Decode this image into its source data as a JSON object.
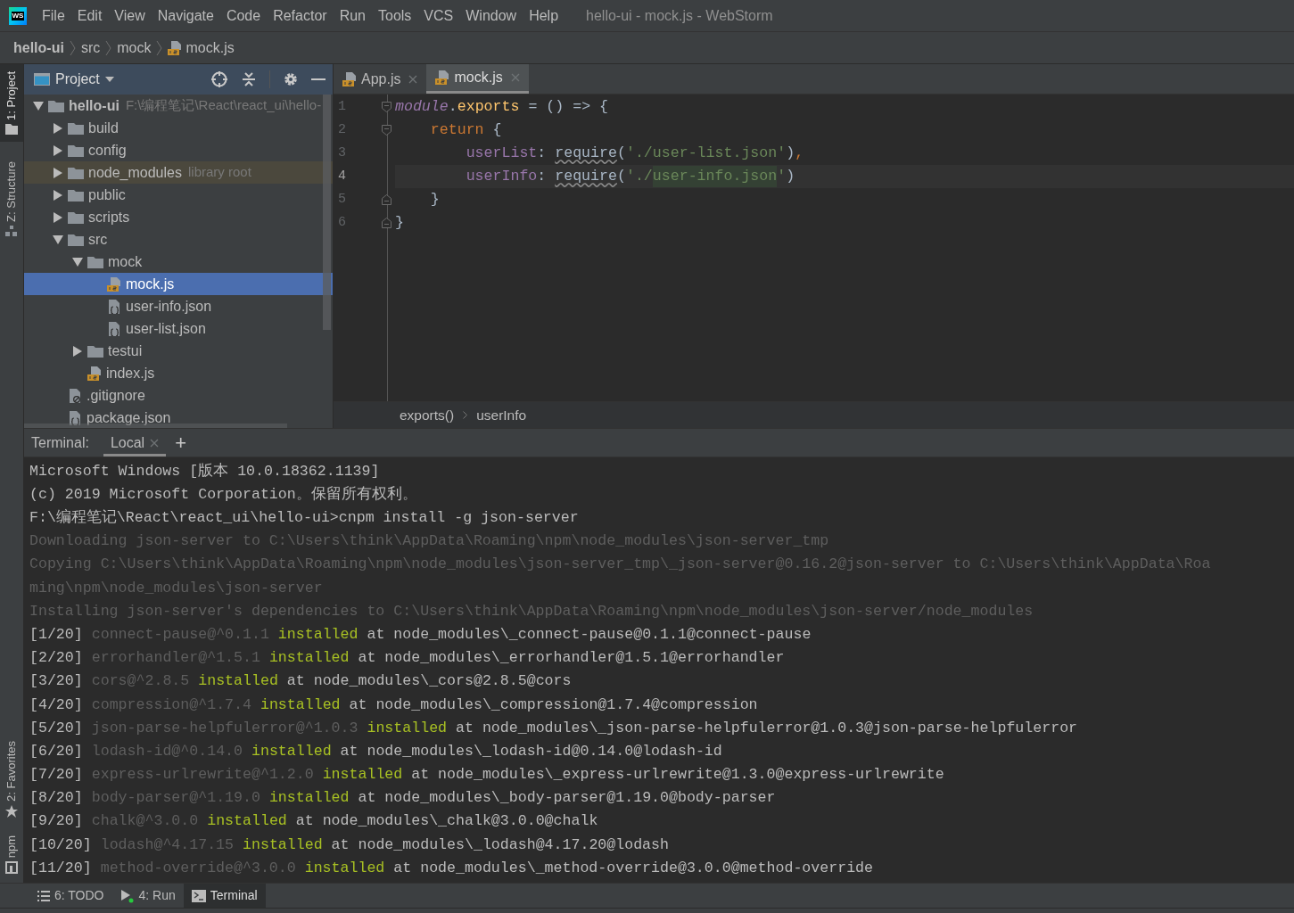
{
  "menu_bar": {
    "logo": "WS",
    "items": [
      "File",
      "Edit",
      "View",
      "Navigate",
      "Code",
      "Refactor",
      "Run",
      "Tools",
      "VCS",
      "Window",
      "Help"
    ],
    "window_title": "hello-ui - mock.js - WebStorm"
  },
  "breadcrumb": [
    {
      "label": "hello-ui",
      "kind": "root"
    },
    {
      "label": "src",
      "kind": "folder"
    },
    {
      "label": "mock",
      "kind": "folder"
    },
    {
      "label": "mock.js",
      "kind": "js"
    }
  ],
  "left_strip": {
    "top": [
      {
        "label": "1: Project",
        "selected": true,
        "kind": "folder"
      },
      {
        "label": "Z: Structure",
        "selected": false,
        "kind": "structure"
      }
    ],
    "bottom": [
      {
        "label": "2: Favorites",
        "selected": false,
        "kind": "star"
      },
      {
        "label": "npm",
        "selected": false,
        "kind": "npm"
      }
    ]
  },
  "project_panel": {
    "title": "Project",
    "tree": [
      {
        "label": "hello-ui",
        "note": "F:\\编程笔记\\React\\react_ui\\hello-",
        "kind": "root",
        "expanded": true,
        "selected": false,
        "children": [
          {
            "label": "build",
            "kind": "folder",
            "expanded": false,
            "selected": false
          },
          {
            "label": "config",
            "kind": "folder",
            "expanded": false,
            "selected": false
          },
          {
            "label": "node_modules",
            "note": "library root",
            "kind": "library",
            "expanded": false,
            "selected": false
          },
          {
            "label": "public",
            "kind": "folder",
            "expanded": false,
            "selected": false
          },
          {
            "label": "scripts",
            "kind": "folder",
            "expanded": false,
            "selected": false
          },
          {
            "label": "src",
            "kind": "folder",
            "expanded": true,
            "selected": false,
            "children": [
              {
                "label": "mock",
                "kind": "folder",
                "expanded": true,
                "selected": false,
                "children": [
                  {
                    "label": "mock.js",
                    "kind": "js",
                    "selected": true
                  },
                  {
                    "label": "user-info.json",
                    "kind": "json",
                    "selected": false
                  },
                  {
                    "label": "user-list.json",
                    "kind": "json",
                    "selected": false
                  }
                ]
              },
              {
                "label": "testui",
                "kind": "folder",
                "expanded": false,
                "selected": false
              },
              {
                "label": "index.js",
                "kind": "js",
                "selected": false
              }
            ]
          },
          {
            "label": ".gitignore",
            "kind": "ignore",
            "selected": false
          },
          {
            "label": "package.json",
            "kind": "json",
            "selected": false
          }
        ]
      }
    ]
  },
  "editor": {
    "tabs": [
      {
        "label": "App.js",
        "selected": false
      },
      {
        "label": "mock.js",
        "selected": true
      }
    ],
    "lines": [
      {
        "number": "1",
        "fold_start": true,
        "fold_end": false,
        "current": false,
        "tokens": [
          {
            "text": "module",
            "kind": "italic"
          },
          {
            "text": ".",
            "kind": "plain"
          },
          {
            "text": "exports",
            "kind": "method"
          },
          {
            "text": " = () => {",
            "kind": "plain"
          }
        ]
      },
      {
        "number": "2",
        "fold_start": true,
        "fold_end": false,
        "current": false,
        "tokens": [
          {
            "text": "    return",
            "kind": "keyword"
          },
          {
            "text": " {",
            "kind": "plain"
          }
        ]
      },
      {
        "number": "3",
        "fold_start": false,
        "fold_end": false,
        "current": false,
        "tokens": [
          {
            "text": "        userList",
            "kind": "property"
          },
          {
            "text": ": ",
            "kind": "plain"
          },
          {
            "text": "require",
            "kind": "call"
          },
          {
            "text": "(",
            "kind": "plain"
          },
          {
            "text": "'./user-list.json'",
            "kind": "string"
          },
          {
            "text": ")",
            "kind": "plain"
          },
          {
            "text": ",",
            "kind": "keyword"
          }
        ]
      },
      {
        "number": "4",
        "fold_start": false,
        "fold_end": false,
        "current": true,
        "tokens": [
          {
            "text": "        userInfo",
            "kind": "property"
          },
          {
            "text": ": ",
            "kind": "plain"
          },
          {
            "text": "require",
            "kind": "call"
          },
          {
            "text": "(",
            "kind": "plain"
          },
          {
            "text": "'./",
            "kind": "string"
          },
          {
            "text": "user-info.json",
            "kind": "string-match"
          },
          {
            "text": "'",
            "kind": "string"
          },
          {
            "text": ")",
            "kind": "plain"
          }
        ]
      },
      {
        "number": "5",
        "fold_start": false,
        "fold_end": true,
        "current": false,
        "tokens": [
          {
            "text": "    }",
            "kind": "plain"
          }
        ]
      },
      {
        "number": "6",
        "fold_start": false,
        "fold_end": true,
        "current": false,
        "tokens": [
          {
            "text": "}",
            "kind": "plain"
          }
        ]
      }
    ],
    "breadcrumb": [
      "exports()",
      "userInfo"
    ]
  },
  "terminal": {
    "label": "Terminal:",
    "tabs": [
      {
        "label": "Local",
        "selected": true
      }
    ],
    "add": "+",
    "lines": [
      [
        {
          "text": "Microsoft Windows [版本 10.0.18362.1139]",
          "kind": "plain"
        }
      ],
      [
        {
          "text": "(c) 2019 Microsoft Corporation。保留所有权利。",
          "kind": "plain"
        }
      ],
      [
        {
          "text": "F:\\编程笔记\\React\\react_ui\\hello-ui>cnpm install -g json-server",
          "kind": "plain"
        }
      ],
      [
        {
          "text": "Downloading json-server to C:\\Users\\think\\AppData\\Roaming\\npm\\node_modules\\json-server_tmp",
          "kind": "dim"
        }
      ],
      [
        {
          "text": "Copying C:\\Users\\think\\AppData\\Roaming\\npm\\node_modules\\json-server_tmp\\_json-server@0.16.2@json-server to C:\\Users\\think\\AppData\\Roa",
          "kind": "dim"
        }
      ],
      [
        {
          "text": "ming\\npm\\node_modules\\json-server",
          "kind": "dim"
        }
      ],
      [
        {
          "text": "Installing json-server's dependencies to C:\\Users\\think\\AppData\\Roaming\\npm\\node_modules\\json-server/node_modules",
          "kind": "dim"
        }
      ],
      [
        {
          "text": "[1/20] ",
          "kind": "plain"
        },
        {
          "text": "connect-pause@^0.1.1",
          "kind": "dim"
        },
        {
          "text": " installed",
          "kind": "green"
        },
        {
          "text": " at node_modules\\_connect-pause@0.1.1@connect-pause",
          "kind": "plain"
        }
      ],
      [
        {
          "text": "[2/20] ",
          "kind": "plain"
        },
        {
          "text": "errorhandler@^1.5.1",
          "kind": "dim"
        },
        {
          "text": " installed",
          "kind": "green"
        },
        {
          "text": " at node_modules\\_errorhandler@1.5.1@errorhandler",
          "kind": "plain"
        }
      ],
      [
        {
          "text": "[3/20] ",
          "kind": "plain"
        },
        {
          "text": "cors@^2.8.5",
          "kind": "dim"
        },
        {
          "text": " installed",
          "kind": "green"
        },
        {
          "text": " at node_modules\\_cors@2.8.5@cors",
          "kind": "plain"
        }
      ],
      [
        {
          "text": "[4/20] ",
          "kind": "plain"
        },
        {
          "text": "compression@^1.7.4",
          "kind": "dim"
        },
        {
          "text": " installed",
          "kind": "green"
        },
        {
          "text": " at node_modules\\_compression@1.7.4@compression",
          "kind": "plain"
        }
      ],
      [
        {
          "text": "[5/20] ",
          "kind": "plain"
        },
        {
          "text": "json-parse-helpfulerror@^1.0.3",
          "kind": "dim"
        },
        {
          "text": " installed",
          "kind": "green"
        },
        {
          "text": " at node_modules\\_json-parse-helpfulerror@1.0.3@json-parse-helpfulerror",
          "kind": "plain"
        }
      ],
      [
        {
          "text": "[6/20] ",
          "kind": "plain"
        },
        {
          "text": "lodash-id@^0.14.0",
          "kind": "dim"
        },
        {
          "text": " installed",
          "kind": "green"
        },
        {
          "text": " at node_modules\\_lodash-id@0.14.0@lodash-id",
          "kind": "plain"
        }
      ],
      [
        {
          "text": "[7/20] ",
          "kind": "plain"
        },
        {
          "text": "express-urlrewrite@^1.2.0",
          "kind": "dim"
        },
        {
          "text": " installed",
          "kind": "green"
        },
        {
          "text": " at node_modules\\_express-urlrewrite@1.3.0@express-urlrewrite",
          "kind": "plain"
        }
      ],
      [
        {
          "text": "[8/20] ",
          "kind": "plain"
        },
        {
          "text": "body-parser@^1.19.0",
          "kind": "dim"
        },
        {
          "text": " installed",
          "kind": "green"
        },
        {
          "text": " at node_modules\\_body-parser@1.19.0@body-parser",
          "kind": "plain"
        }
      ],
      [
        {
          "text": "[9/20] ",
          "kind": "plain"
        },
        {
          "text": "chalk@^3.0.0",
          "kind": "dim"
        },
        {
          "text": " installed",
          "kind": "green"
        },
        {
          "text": " at node_modules\\_chalk@3.0.0@chalk",
          "kind": "plain"
        }
      ],
      [
        {
          "text": "[10/20] ",
          "kind": "plain"
        },
        {
          "text": "lodash@^4.17.15",
          "kind": "dim"
        },
        {
          "text": " installed",
          "kind": "green"
        },
        {
          "text": " at node_modules\\_lodash@4.17.20@lodash",
          "kind": "plain"
        }
      ],
      [
        {
          "text": "[11/20] ",
          "kind": "plain"
        },
        {
          "text": "method-override@^3.0.0",
          "kind": "dim"
        },
        {
          "text": " installed",
          "kind": "green"
        },
        {
          "text": " at node_modules\\_method-override@3.0.0@method-override",
          "kind": "plain"
        }
      ]
    ]
  },
  "bottom_bar": [
    {
      "label": "6: TODO",
      "kind": "todo",
      "selected": false
    },
    {
      "label": "4: Run",
      "kind": "run",
      "selected": false
    },
    {
      "label": "Terminal",
      "kind": "terminal",
      "selected": true
    }
  ]
}
